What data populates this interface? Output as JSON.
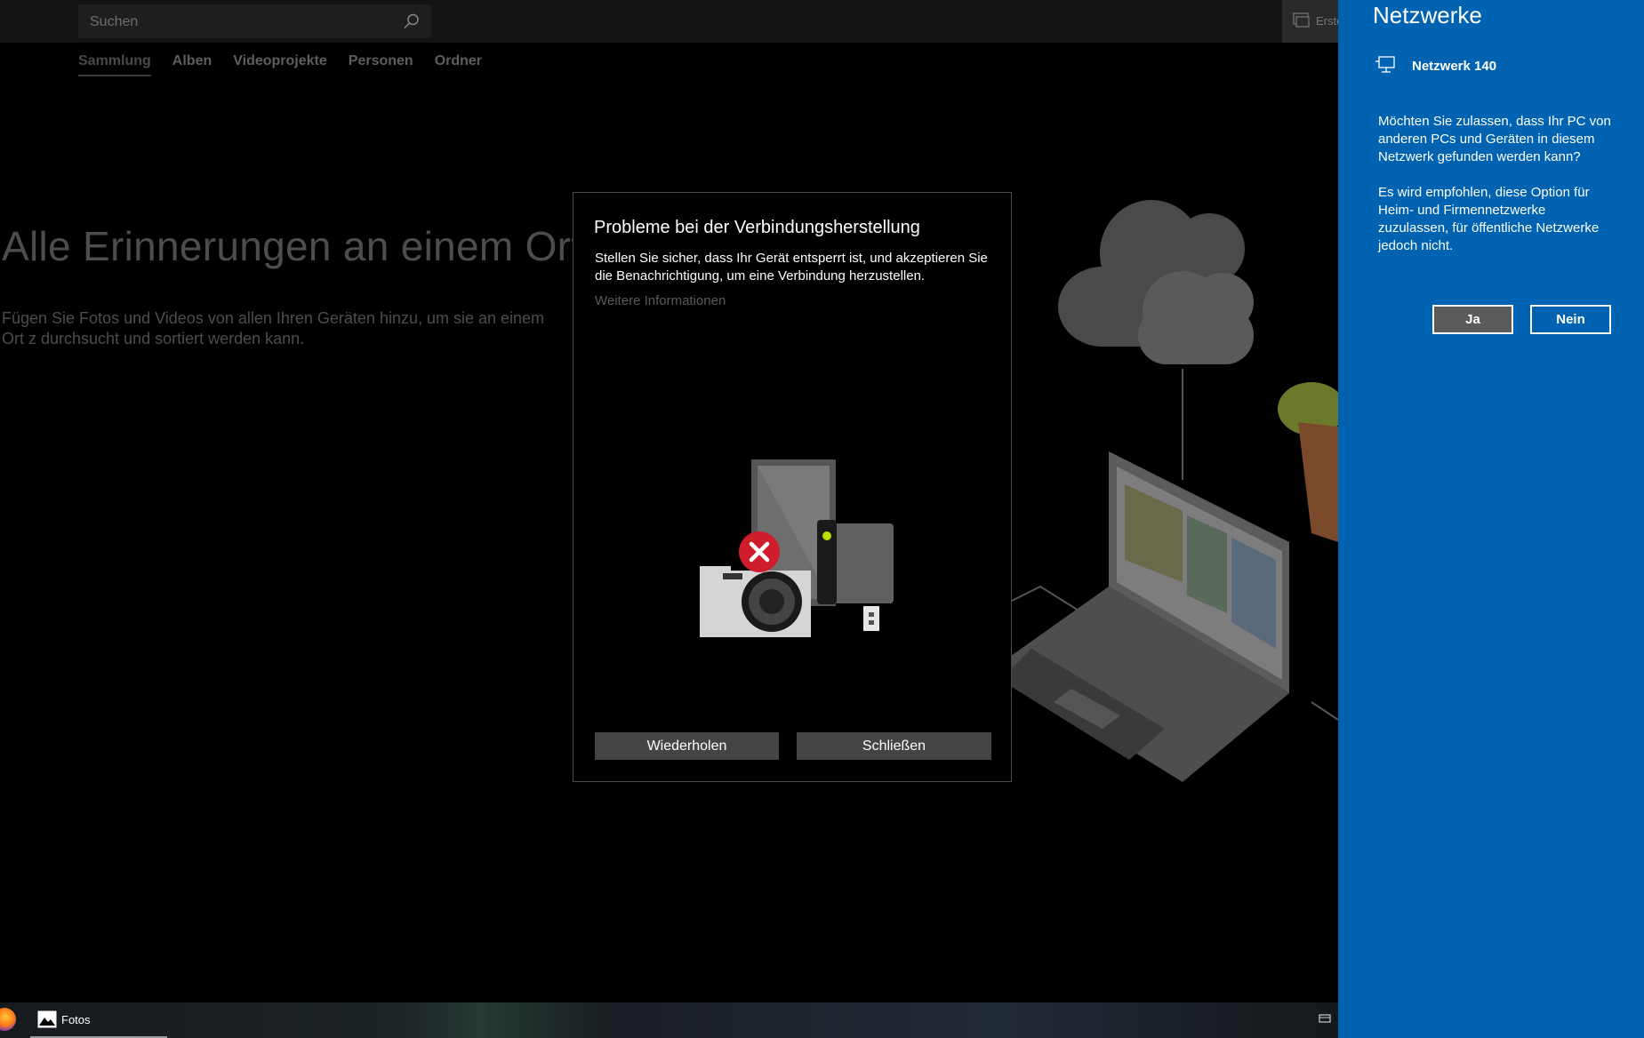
{
  "app": {
    "search": {
      "placeholder": "Suchen"
    },
    "create_label": "Erste",
    "tabs": [
      {
        "label": "Sammlung",
        "active": true
      },
      {
        "label": "Alben"
      },
      {
        "label": "Videoprojekte"
      },
      {
        "label": "Personen"
      },
      {
        "label": "Ordner"
      }
    ],
    "hero_title": "Alle Erinnerungen an einem Ort s",
    "hero_description": "Fügen Sie Fotos und Videos von allen Ihren Geräten hinzu, um sie an einem Ort z durchsucht und sortiert werden kann."
  },
  "dialog": {
    "title": "Probleme bei der Verbindungsherstellung",
    "body": "Stellen Sie sicher, dass Ihr Gerät entsperrt ist, und akzeptieren Sie die Benachrichtigung, um eine Verbindung herzustellen.",
    "link": "Weitere Informationen",
    "retry_label": "Wiederholen",
    "close_label": "Schließen"
  },
  "flyout": {
    "title": "Netzwerke",
    "network_name": "Netzwerk 140",
    "question": "Möchten Sie zulassen, dass Ihr PC von anderen PCs und Geräten in diesem Netzwerk gefunden werden kann?",
    "recommendation": "Es wird empfohlen, diese Option für Heim- und Firmennetzwerke zuzulassen, für öffentliche Netzwerke jedoch nicht.",
    "yes_label": "Ja",
    "no_label": "Nein",
    "background_color": "#0063b1"
  },
  "taskbar": {
    "app_label": "Fotos"
  },
  "icons": [
    "search-icon",
    "create-icon",
    "network-monitor-icon",
    "firefox-icon",
    "photos-icon",
    "tray-icon",
    "error-icon"
  ]
}
